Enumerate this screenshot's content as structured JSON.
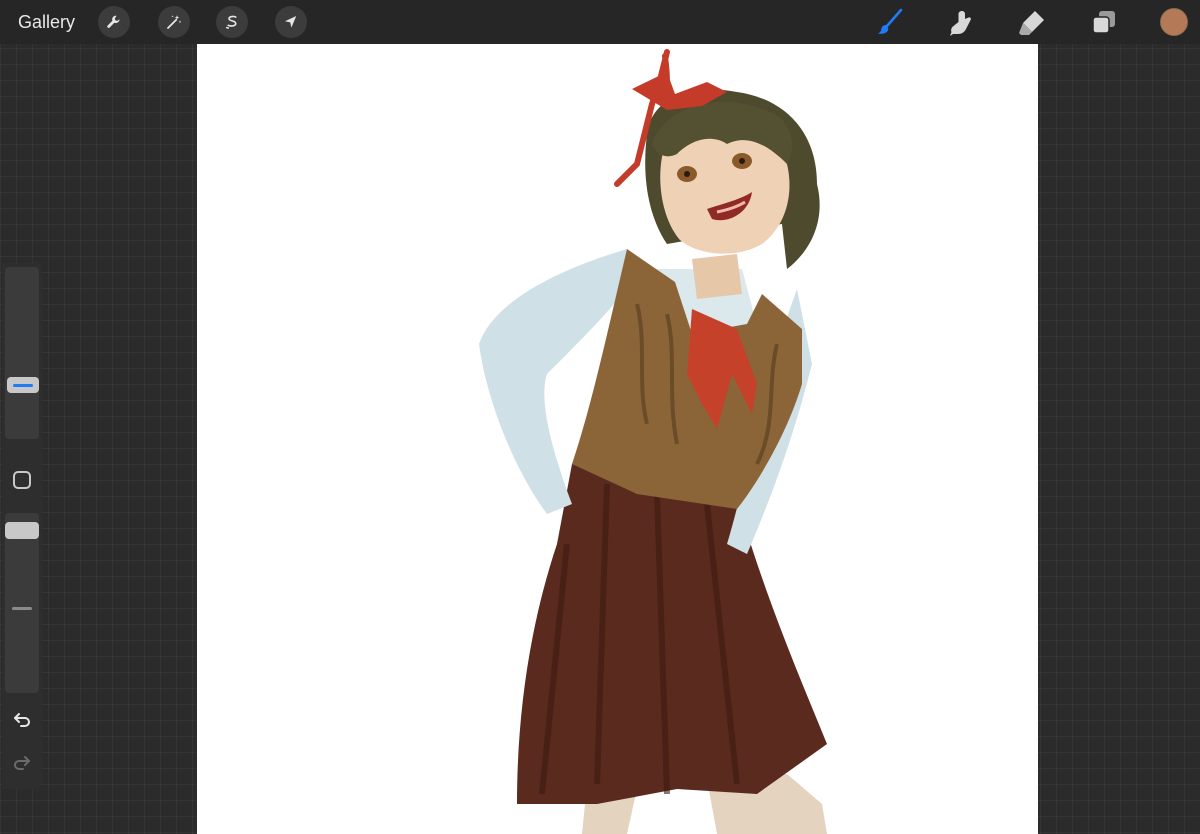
{
  "toolbar": {
    "gallery_label": "Gallery",
    "left_tools": [
      {
        "name": "actions",
        "icon": "wrench-icon"
      },
      {
        "name": "adjustments",
        "icon": "magic-wand-icon"
      },
      {
        "name": "selection",
        "icon": "selection-s-icon"
      },
      {
        "name": "transform",
        "icon": "arrow-cursor-icon"
      }
    ],
    "right_tools": [
      {
        "name": "brush",
        "icon": "brush-icon",
        "active": true
      },
      {
        "name": "smudge",
        "icon": "smudge-icon",
        "active": false
      },
      {
        "name": "eraser",
        "icon": "eraser-icon",
        "active": false
      },
      {
        "name": "layers",
        "icon": "layers-icon",
        "active": false
      }
    ],
    "current_color": "#b47a57",
    "accent_color": "#1e7cf5"
  },
  "sidebar": {
    "brush_size_icon": "size-slider-icon",
    "modify_button_icon": "square-icon",
    "opacity_icon": "opacity-slider-icon",
    "undo_icon": "undo-icon",
    "redo_icon": "redo-icon"
  },
  "canvas": {
    "background": "#ffffff",
    "artwork": "illustration-girl-icon"
  }
}
